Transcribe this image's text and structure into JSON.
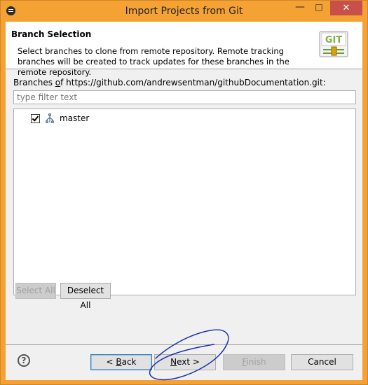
{
  "window": {
    "title": "Import Projects from Git",
    "minimize": "—",
    "maximize": "□",
    "close": "✕"
  },
  "header": {
    "title": "Branch Selection",
    "description": "Select branches to clone from remote repository. Remote tracking branches will be created to track updates for these branches in the remote repository.",
    "logo_text": "GIT"
  },
  "branches": {
    "label_prefix": "Branches ",
    "label_mnemonic": "o",
    "label_rest": "f https://github.com/andrewsentman/githubDocumentation.git:",
    "filter_placeholder": "type filter text",
    "items": [
      {
        "label": "master",
        "checked": true
      }
    ]
  },
  "selection": {
    "select_all": "Select All",
    "deselect_all": "Deselect All"
  },
  "footer": {
    "help": "?",
    "back_prefix": "< ",
    "back_mnemonic": "B",
    "back_rest": "ack",
    "next_mnemonic": "N",
    "next_rest": "ext >",
    "finish_mnemonic": "F",
    "finish_rest": "inish",
    "cancel": "Cancel"
  },
  "colors": {
    "title_bar": "#f4a234",
    "close_button": "#c7504a",
    "annotation_ink": "#1a2fb0"
  },
  "icons": {
    "system_menu": "window-menu-icon",
    "logo": "git-logo-icon",
    "branch": "branch-icon",
    "help": "help-icon"
  }
}
